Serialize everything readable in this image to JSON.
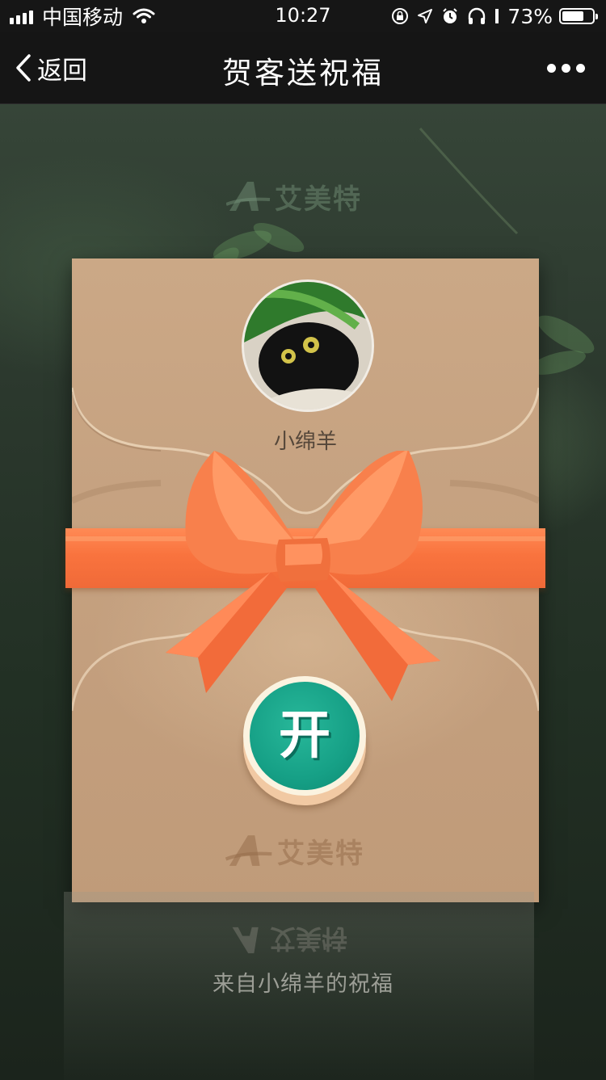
{
  "status_bar": {
    "carrier": "中国移动",
    "time": "10:27",
    "battery_percent": "73%",
    "battery_level": 0.73,
    "icons": [
      "signal-bars-icon",
      "wifi-icon",
      "rotation-lock-icon",
      "location-arrow-icon",
      "alarm-icon",
      "headphones-icon",
      "battery-icon"
    ]
  },
  "nav": {
    "back_label": "返回",
    "title": "贺客送祝福",
    "icons": [
      "back-chevron-icon",
      "more-dots-icon"
    ]
  },
  "envelope": {
    "brand_logo": "艾美特",
    "sender_name": "小绵羊",
    "open_label": "开",
    "ribbon_color": "#f9733e",
    "button_color": "#16a086"
  },
  "background": {
    "brand_logo": "艾美特"
  },
  "footer": {
    "blessing_text": "来自小绵羊的祝福"
  }
}
